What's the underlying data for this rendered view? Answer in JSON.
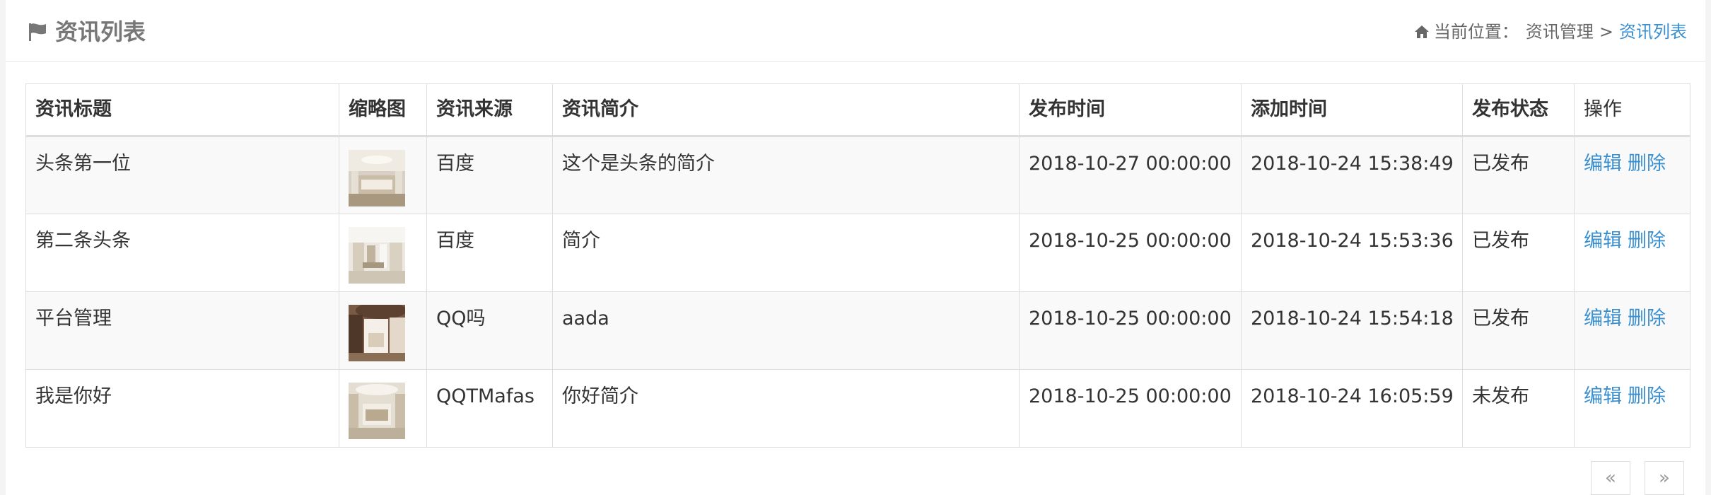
{
  "header": {
    "title": "资讯列表",
    "title_icon": "flag-icon",
    "breadcrumb": {
      "icon": "home-icon",
      "label": "当前位置：",
      "items": [
        "资讯管理",
        "资讯列表"
      ],
      "separator": ">"
    }
  },
  "table": {
    "columns": [
      "资讯标题",
      "缩略图",
      "资讯来源",
      "资讯简介",
      "发布时间",
      "添加时间",
      "发布状态",
      "操作"
    ],
    "rows": [
      {
        "title": "头条第一位",
        "source": "百度",
        "summary": "这个是头条的简介",
        "publish_time": "2018-10-27 00:00:00",
        "add_time": "2018-10-24 15:38:49",
        "status": "已发布",
        "edit": "编辑",
        "delete": "删除"
      },
      {
        "title": "第二条头条",
        "source": "百度",
        "summary": "简介",
        "publish_time": "2018-10-25 00:00:00",
        "add_time": "2018-10-24 15:53:36",
        "status": "已发布",
        "edit": "编辑",
        "delete": "删除"
      },
      {
        "title": "平台管理",
        "source": "QQ吗",
        "summary": "aada",
        "publish_time": "2018-10-25 00:00:00",
        "add_time": "2018-10-24 15:54:18",
        "status": "已发布",
        "edit": "编辑",
        "delete": "删除"
      },
      {
        "title": "我是你好",
        "source": "QQTMafas",
        "summary": "你好简介",
        "publish_time": "2018-10-25 00:00:00",
        "add_time": "2018-10-24 16:05:59",
        "status": "未发布",
        "edit": "编辑",
        "delete": "删除"
      }
    ]
  },
  "pagination": {
    "prev": "«",
    "next": "»"
  },
  "colors": {
    "link": "#3a8fd0",
    "title": "#777777"
  }
}
